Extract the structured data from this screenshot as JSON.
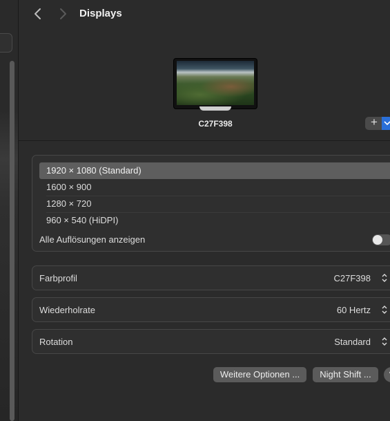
{
  "header": {
    "title": "Displays",
    "back_icon": "chevron-left-icon",
    "forward_icon": "chevron-right-icon"
  },
  "display": {
    "name": "C27F398",
    "add_label": "+"
  },
  "resolutions": {
    "items": [
      {
        "label": "1920 × 1080 (Standard)",
        "selected": true
      },
      {
        "label": "1600 × 900",
        "selected": false
      },
      {
        "label": "1280 × 720",
        "selected": false
      },
      {
        "label": "960 × 540 (HiDPI)",
        "selected": false
      }
    ],
    "show_all_label": "Alle Auflösungen anzeigen",
    "show_all_enabled": false
  },
  "settings": {
    "color_profile": {
      "label": "Farbprofil",
      "value": "C27F398"
    },
    "refresh_rate": {
      "label": "Wiederholrate",
      "value": "60 Hertz"
    },
    "rotation": {
      "label": "Rotation",
      "value": "Standard"
    }
  },
  "buttons": {
    "advanced": "Weitere Optionen ...",
    "night_shift": "Night Shift ...",
    "help": "?"
  },
  "colors": {
    "background": "#2b2b2b",
    "accent": "#2a6fd8",
    "selected_row": "#5e5e5e"
  }
}
